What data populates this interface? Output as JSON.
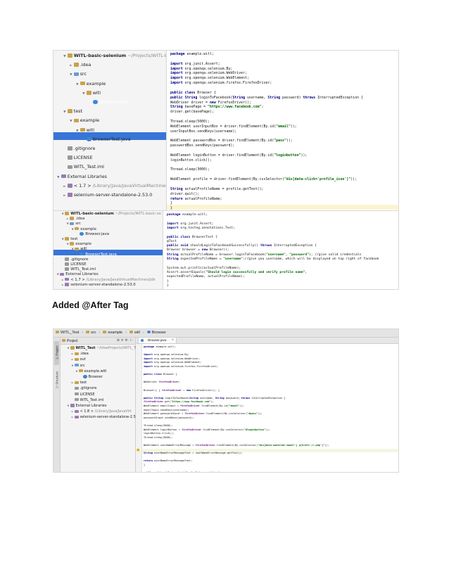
{
  "caption": "Added @After Tag",
  "shot1": {
    "tree": [
      {
        "indent": 0,
        "tw": "▼",
        "icon": "f",
        "text": "WITL-basic-selenium",
        "suffix": " ~/Projects/WITL-basic-se",
        "bold": true
      },
      {
        "indent": 1,
        "tw": "►",
        "icon": "f",
        "text": ".idea"
      },
      {
        "indent": 1,
        "tw": "▼",
        "icon": "s",
        "text": "src"
      },
      {
        "indent": 2,
        "tw": "▼",
        "icon": "f",
        "text": "example"
      },
      {
        "indent": 3,
        "tw": "▼",
        "icon": "f",
        "text": "witl"
      },
      {
        "indent": 4,
        "tw": "",
        "icon": "c",
        "text": "Browser.java",
        "selected": true
      },
      {
        "indent": 0,
        "tw": "▼",
        "icon": "f",
        "text": "test"
      },
      {
        "indent": 1,
        "tw": "▼",
        "icon": "f",
        "text": "example"
      },
      {
        "indent": 2,
        "tw": "▼",
        "icon": "f",
        "text": "witl"
      },
      {
        "indent": 3,
        "tw": "",
        "icon": "c",
        "text": "BrowserTest.java"
      },
      {
        "indent": 0,
        "tw": "",
        "icon": "x",
        "text": ".gitignore"
      },
      {
        "indent": 0,
        "tw": "",
        "icon": "x",
        "text": "LICENSE"
      },
      {
        "indent": 0,
        "tw": "",
        "icon": "x",
        "text": "WITL_Test.iml"
      },
      {
        "indent": -1,
        "tw": "▼",
        "icon": "l",
        "text": "External Libraries"
      },
      {
        "indent": 0,
        "tw": "►",
        "icon": "l",
        "text": "< 1.7 >",
        "suffix": " /Library/Java/JavaVirtualMachines/jdk"
      },
      {
        "indent": 0,
        "tw": "►",
        "icon": "l",
        "text": "selenium-server-standalone-2.53.0"
      }
    ],
    "code": [
      "package example.witl;",
      "",
      "import org.junit.Assert;",
      "import org.openqa.selenium.By;",
      "import org.openqa.selenium.WebDriver;",
      "import org.openqa.selenium.WebElement;",
      "import org.openqa.selenium.firefox.FirefoxDriver;",
      "",
      "public class Browser {",
      "    public String loginToFacebook(String username, String password) throws InterruptedException {",
      "        WebDriver driver = new FirefoxDriver();",
      "        String basePage = \"https://www.facebook.com\";",
      "        driver.get(basePage);",
      "",
      "        Thread.sleep(5000);",
      "        WebElement userInputBox = driver.findElement(By.id(\"email\"));",
      "        userInputBox.sendKeys(username);",
      "",
      "        WebElement passwordBox = driver.findElement(By.id(\"pass\"));",
      "        passwordBox.sendKeys(password);",
      "",
      "        WebElement loginButton = driver.findElement(By.id(\"loginbutton\"));",
      "        loginButton.click();",
      "",
      "        Thread.sleep(3000);",
      "",
      "        WebElement profile = driver.findElement(By.cssSelector(\"div[data-click='profile_icon']\"));",
      "",
      "        String actualProfileName = profile.getText();",
      "        driver.quit();",
      "        return  actualProfileName;",
      "    }",
      "}"
    ]
  },
  "shot2": {
    "tree": [
      {
        "indent": 0,
        "tw": "▼",
        "icon": "f",
        "text": "WITL-basic-selenium",
        "suffix": " ~/Projects/WITL-basic-se",
        "bold": true
      },
      {
        "indent": 1,
        "tw": "►",
        "icon": "f",
        "text": ".idea"
      },
      {
        "indent": 1,
        "tw": "▼",
        "icon": "s",
        "text": "src"
      },
      {
        "indent": 2,
        "tw": "▼",
        "icon": "f",
        "text": "example"
      },
      {
        "indent": 3,
        "tw": "",
        "icon": "c",
        "text": "Browser.java"
      },
      {
        "indent": 0,
        "tw": "▼",
        "icon": "f",
        "text": "test"
      },
      {
        "indent": 1,
        "tw": "▼",
        "icon": "f",
        "text": "example"
      },
      {
        "indent": 2,
        "tw": "▼",
        "icon": "f",
        "text": "witl"
      },
      {
        "indent": 3,
        "tw": "",
        "icon": "c",
        "text": "BrowserTest.java",
        "selected": true
      },
      {
        "indent": 0,
        "tw": "",
        "icon": "x",
        "text": ".gitignore"
      },
      {
        "indent": 0,
        "tw": "",
        "icon": "x",
        "text": "LICENSE"
      },
      {
        "indent": 0,
        "tw": "",
        "icon": "x",
        "text": "WITL_Test.iml"
      },
      {
        "indent": -1,
        "tw": "▼",
        "icon": "l",
        "text": "External Libraries"
      },
      {
        "indent": 0,
        "tw": "►",
        "icon": "l",
        "text": "< 1.7 >",
        "suffix": " /Library/Java/JavaVirtualMachines/jdk"
      },
      {
        "indent": 0,
        "tw": "►",
        "icon": "l",
        "text": "selenium-server-standalone-2.53.0"
      }
    ],
    "code": [
      "package example.witl;",
      "",
      "import org.junit.Assert;",
      "import org.testng.annotations.Test;",
      "",
      "public class BrowserTest {",
      "    @Test",
      "    public void shouldLoginToFacebookSuccessfully() throws InterruptedException {",
      "        Browser browser = new Browser();",
      "        String actualProfileName = browser.loginToFacebook(\"username\", \"password\"); //give valid credentials",
      "        String expectedProfileName = \"username\";//give you username, which will be displayed on top right of facebook",
      "",
      "        System.out.println(actualProfileName);",
      "        Assert.assertEquals(\"Should login successfully and verify profile name\",",
      "                expectedProfileName, actualProfileName);",
      "    }",
      "}"
    ]
  },
  "shot3": {
    "breadcrumbs": [
      "WITL_Test",
      "src",
      "example",
      "witl",
      "Browser"
    ],
    "sidebar_labels": [
      "1: Project",
      "2: Structure"
    ],
    "panel_title": "Project",
    "panel_tools": "⊕ ≑ ✲· ⊢",
    "editor_tab": "Browser.java",
    "tree": [
      {
        "indent": 0,
        "tw": "▼",
        "icon": "f",
        "text": "WITL_Test",
        "suffix": " ~/IdeaProjects/WITL_Tes",
        "bold": true
      },
      {
        "indent": 1,
        "tw": "►",
        "icon": "f",
        "text": ".idea"
      },
      {
        "indent": 1,
        "tw": "►",
        "icon": "f",
        "text": "out"
      },
      {
        "indent": 1,
        "tw": "▼",
        "icon": "s",
        "text": "src"
      },
      {
        "indent": 2,
        "tw": "▼",
        "icon": "f",
        "text": "example.witl"
      },
      {
        "indent": 3,
        "tw": "",
        "icon": "c",
        "text": "Browser"
      },
      {
        "indent": 1,
        "tw": "►",
        "icon": "f",
        "text": "test"
      },
      {
        "indent": 1,
        "tw": "",
        "icon": "x",
        "text": ".gitignore"
      },
      {
        "indent": 1,
        "tw": "",
        "icon": "x",
        "text": "LICENSE"
      },
      {
        "indent": 1,
        "tw": "",
        "icon": "x",
        "text": "WITL_Test.iml"
      },
      {
        "indent": 0,
        "tw": "▼",
        "icon": "l",
        "text": "External Libraries"
      },
      {
        "indent": 1,
        "tw": "►",
        "icon": "l",
        "text": "< 1.8 >",
        "suffix": " /Library/Java/JavaVirt"
      },
      {
        "indent": 1,
        "tw": "►",
        "icon": "l",
        "text": "selenium-server-standalone-2.5"
      }
    ],
    "code": [
      "package example.witl;",
      "",
      "import org.openqa.selenium.By;",
      "import org.openqa.selenium.WebDriver;",
      "import org.openqa.selenium.WebElement;",
      "import org.openqa.selenium.firefox.FirefoxDriver;",
      "",
      "public class Browser {",
      "",
      "    WebDriver firefoxDriver;",
      "",
      "    Browser() { firefoxDriver = new FirefoxDriver(); }",
      "",
      "    public String loginToFacebook(String username, String password) throws InterruptedException {",
      "        firefoxDriver.get(\"https://www.facebook.com\");",
      "        WebElement emailInput = firefoxDriver.findElement(By.id(\"email\"));",
      "        emailInput.sendKeys(username);",
      "        WebElement passwordInput = firefoxDriver.findElement(By.cssSelector(\"#pass\"));",
      "        passwordInput.sendKeys(password);",
      "",
      "        Thread.sleep(3000);",
      "        WebElement loginButton = firefoxDriver.findElement(By.cssSelector(\"#loginbutton\"));",
      "        loginButton.click();",
      "        Thread.sleep(3000);",
      "",
      "        WebElement userNameErrorMessage = firefoxDriver.findElement(By.cssSelector(\"div[data-ownerid='email'] a[href='/r.php']\"));",
      "",
      "        String userNameErrorMessageText = userNameErrorMessage.getText();",
      "",
      "        return userNameErrorMessageText;",
      "    }",
      "",
      "    public void quitDriver() { firefoxDriver.quit(); }",
      "}"
    ]
  }
}
